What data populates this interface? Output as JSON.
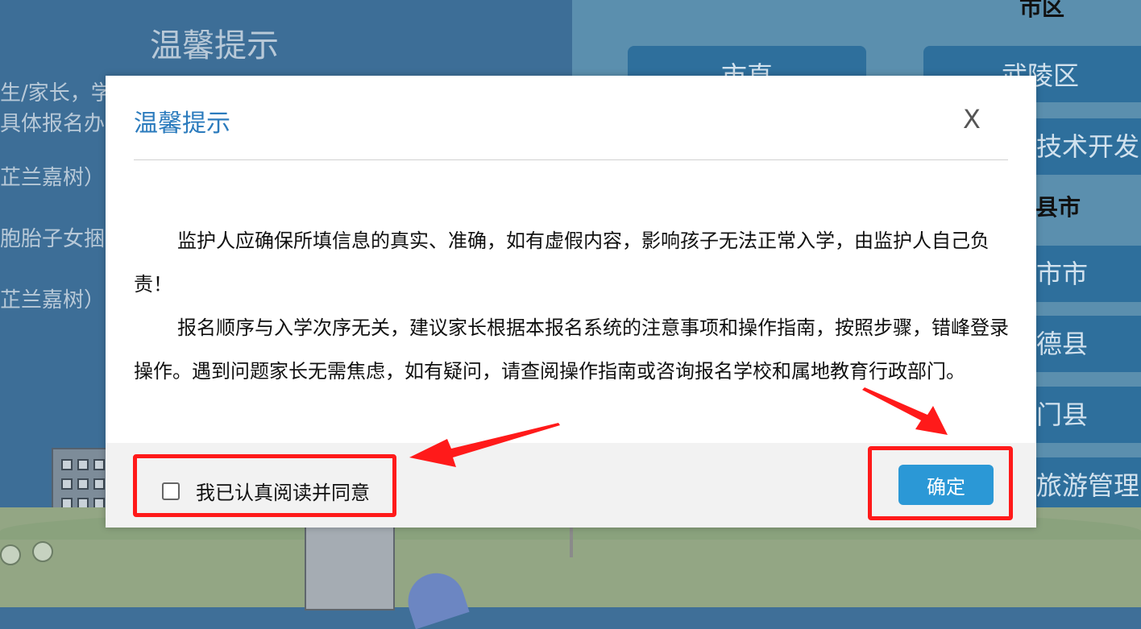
{
  "background": {
    "title": "温馨提示",
    "lines": [
      "生/家长，学",
      "具体报名办法",
      "芷兰嘉树）",
      "胞胎子女捆绑",
      "芷兰嘉树）"
    ],
    "region_heading_top": "市区",
    "region_heading_mid": "县市",
    "regions": [
      "市直",
      "武陵区",
      "技术开发区",
      "市市",
      "德县",
      "门县",
      "旅游管理区"
    ]
  },
  "dialog": {
    "title": "温馨提示",
    "close_label": "X",
    "paragraphs": [
      "监护人应确保所填信息的真实、准确，如有虚假内容，影响孩子无法正常入学，由监护人自己负责！",
      "报名顺序与入学次序无关，建议家长根据本报名系统的注意事项和操作指南，按照步骤，错峰登录操作。遇到问题家长无需焦虑，如有疑问，请查阅操作指南或咨询报名学校和属地教育行政部门。"
    ],
    "agree_label": "我已认真阅读并同意",
    "agree_checked": false,
    "confirm_label": "确定"
  },
  "colors": {
    "accent": "#2b98d6",
    "title_blue": "#2b7bbd",
    "annotation_red": "#ff1a1a"
  }
}
